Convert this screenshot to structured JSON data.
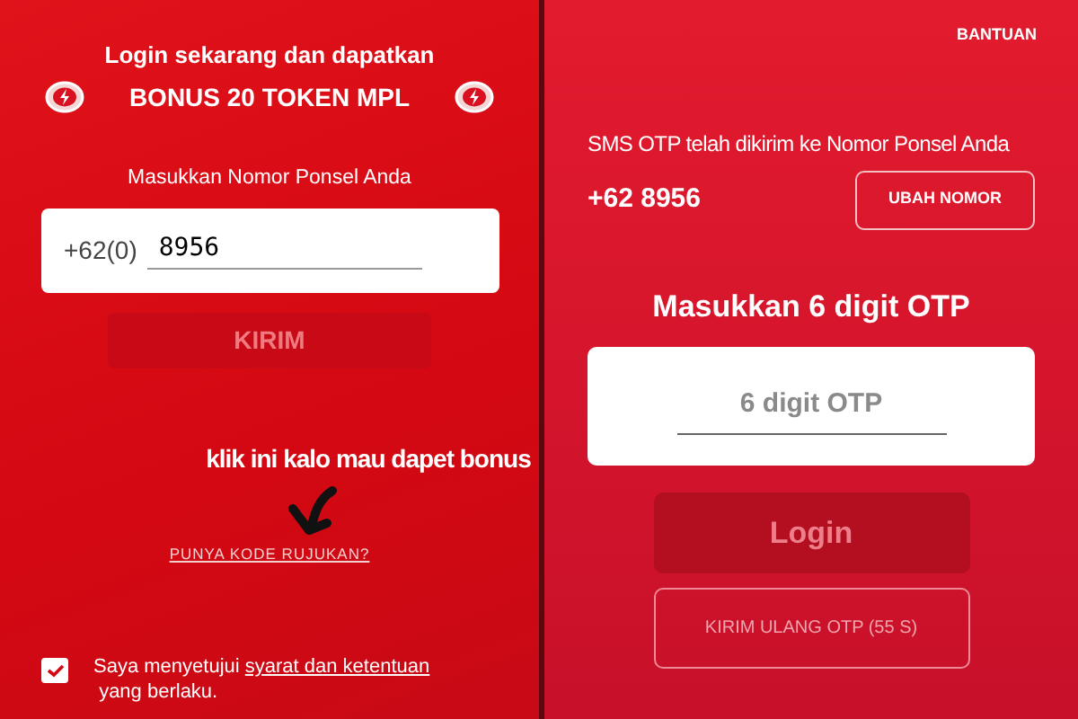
{
  "login_panel": {
    "headline": "Login sekarang dan dapatkan",
    "bonus_title": "BONUS 20 TOKEN MPL",
    "phone_label": "Masukkan Nomor Ponsel Anda",
    "country_prefix": "+62(0)",
    "phone_value": "8956",
    "send_button": {
      "label": "KIRIM",
      "disabled": true
    },
    "annotation": "klik ini kalo mau dapet bonus",
    "referral_link": "PUNYA KODE RUJUKAN?",
    "terms": {
      "checked": true,
      "text": "Saya menyetujui",
      "link": "syarat dan ketentuan",
      "text_after": "yang berlaku."
    }
  },
  "otp_panel": {
    "help_link": "BANTUAN",
    "sent_message": "SMS OTP telah dikirim ke Nomor Ponsel Anda",
    "phone_number": "+62 8956",
    "change_button": "UBAH NOMOR",
    "heading": "Masukkan 6 digit OTP",
    "otp_placeholder": "6 digit OTP",
    "login_button": {
      "label": "Login",
      "disabled": true
    },
    "resend_button": {
      "label": "KIRIM ULANG OTP (55 S)",
      "disabled": true
    }
  }
}
